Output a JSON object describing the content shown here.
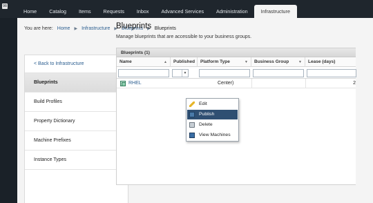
{
  "app_icon": "98",
  "nav": {
    "tabs": [
      {
        "label": "Home"
      },
      {
        "label": "Catalog"
      },
      {
        "label": "Items"
      },
      {
        "label": "Requests"
      },
      {
        "label": "Inbox"
      },
      {
        "label": "Advanced Services"
      },
      {
        "label": "Administration"
      },
      {
        "label": "Infrastructure",
        "active": true
      }
    ]
  },
  "breadcrumb": {
    "label": "You are here:",
    "items": [
      "Home",
      "Infrastructure",
      "Blueprints",
      "Blueprints"
    ]
  },
  "sidebar": {
    "back_label": "< Back to Infrastructure",
    "items": [
      {
        "label": "Blueprints",
        "active": true
      },
      {
        "label": "Build Profiles"
      },
      {
        "label": "Property Dictionary"
      },
      {
        "label": "Machine Prefixes"
      },
      {
        "label": "Instance Types"
      }
    ]
  },
  "main": {
    "title": "Blueprints",
    "subtitle": "Manage blueprints that are accessible to your business groups.",
    "grid": {
      "header": "Blueprints (1)",
      "columns": [
        "Name",
        "Published",
        "Platform Type",
        "Business Group",
        "Lease (days)"
      ],
      "rows": [
        {
          "name": "RHEL",
          "platform_type": "Center)",
          "lease": "2"
        }
      ]
    }
  },
  "context_menu": {
    "items": [
      {
        "label": "Edit",
        "icon": "pencil-icon"
      },
      {
        "label": "Publish",
        "icon": "publish-icon",
        "selected": true
      },
      {
        "label": "Delete",
        "icon": "trash-icon"
      },
      {
        "label": "View Machines",
        "icon": "view-machines-icon"
      }
    ]
  },
  "colors": {
    "topbar": "#1f262d",
    "link": "#2a5d8f",
    "menu_highlight": "#2f4f72"
  }
}
